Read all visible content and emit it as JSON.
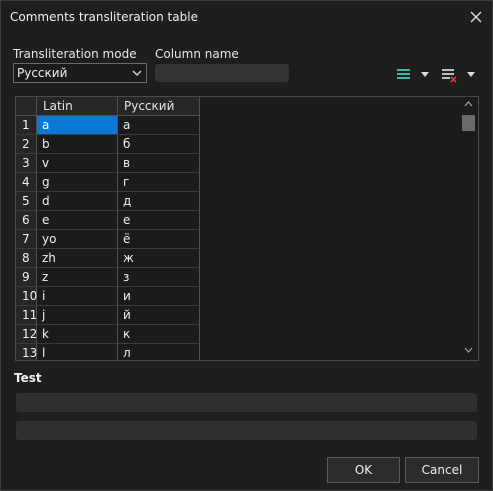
{
  "window": {
    "title": "Comments transliteration table"
  },
  "mode": {
    "label": "Transliteration mode",
    "value": "Русский"
  },
  "column_name": {
    "label": "Column name",
    "value": ""
  },
  "toolbar": {
    "add_icon": "rows-icon",
    "remove_icon": "delete-rows-icon"
  },
  "table": {
    "headers": [
      "Latin",
      "Русский"
    ],
    "rows": [
      {
        "n": "1",
        "latin": "a",
        "ru": "а"
      },
      {
        "n": "2",
        "latin": "b",
        "ru": "б"
      },
      {
        "n": "3",
        "latin": "v",
        "ru": "в"
      },
      {
        "n": "4",
        "latin": "g",
        "ru": "г"
      },
      {
        "n": "5",
        "latin": "d",
        "ru": "д"
      },
      {
        "n": "6",
        "latin": "e",
        "ru": "е"
      },
      {
        "n": "7",
        "latin": "yo",
        "ru": "ё"
      },
      {
        "n": "8",
        "latin": "zh",
        "ru": "ж"
      },
      {
        "n": "9",
        "latin": "z",
        "ru": "з"
      },
      {
        "n": "10",
        "latin": "i",
        "ru": "и"
      },
      {
        "n": "11",
        "latin": "j",
        "ru": "й"
      },
      {
        "n": "12",
        "latin": "k",
        "ru": "к"
      },
      {
        "n": "13",
        "latin": "l",
        "ru": "л"
      }
    ]
  },
  "test": {
    "label": "Test",
    "input1": "",
    "input2": ""
  },
  "buttons": {
    "ok": "OK",
    "cancel": "Cancel"
  },
  "colors": {
    "selection": "#0a78d7",
    "accent_icon": "#3fb6a8",
    "remove_icon": "#e04040"
  }
}
